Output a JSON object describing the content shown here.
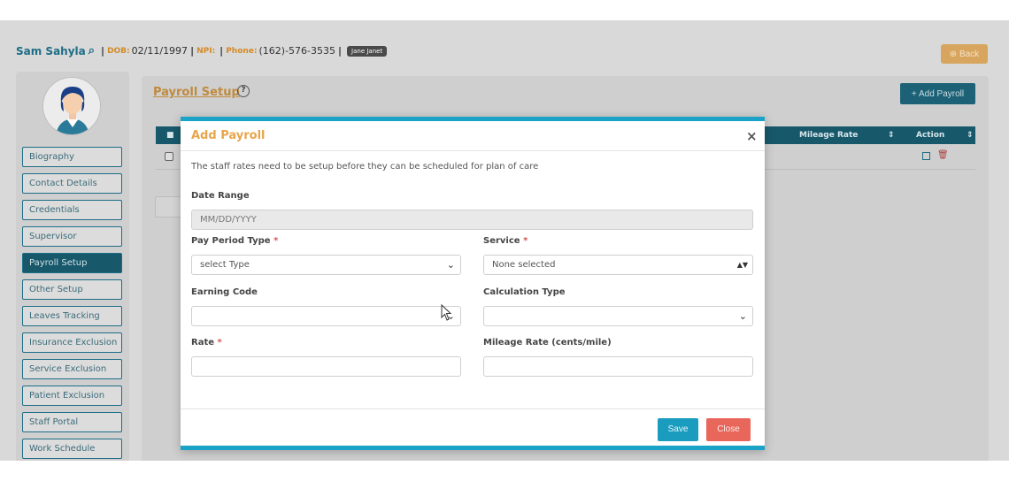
{
  "patient": {
    "name": "Sam Sahyla",
    "search_icon": "search-icon",
    "dob_label": "DOB:",
    "dob_value": "02/11/1997",
    "npi_label": "NPI:",
    "phone_label": "Phone:",
    "phone_value": "(162)-576-3535",
    "badge": "Jane Janet"
  },
  "back_button": "⊕ Back",
  "sidebar": {
    "items": [
      {
        "label": "Biography"
      },
      {
        "label": "Contact Details"
      },
      {
        "label": "Credentials"
      },
      {
        "label": "Supervisor"
      },
      {
        "label": "Payroll Setup"
      },
      {
        "label": "Other Setup"
      },
      {
        "label": "Leaves Tracking"
      },
      {
        "label": "Insurance Exclusion"
      },
      {
        "label": "Service Exclusion"
      },
      {
        "label": "Patient Exclusion"
      },
      {
        "label": "Staff Portal"
      },
      {
        "label": "Work Schedule"
      }
    ],
    "active_index": 4
  },
  "main": {
    "title": "Payroll Setup",
    "add_button": "+ Add Payroll",
    "columns": {
      "mileage_rate": "Mileage Rate",
      "action": "Action"
    }
  },
  "modal": {
    "title": "Add Payroll",
    "close_glyph": "×",
    "note": "The staff rates need to be setup before they can be scheduled for plan of care",
    "date_range": {
      "label": "Date Range",
      "placeholder": "MM/DD/YYYY"
    },
    "pay_period_type": {
      "label": "Pay Period Type",
      "value": "select Type"
    },
    "service": {
      "label": "Service",
      "value": "None selected"
    },
    "earning_code": {
      "label": "Earning Code",
      "value": ""
    },
    "calculation_type": {
      "label": "Calculation Type",
      "value": ""
    },
    "rate": {
      "label": "Rate",
      "value": ""
    },
    "mileage_rate": {
      "label": "Mileage Rate (cents/mile)",
      "value": ""
    },
    "required_mark": "*",
    "save_label": "Save",
    "close_label": "Close"
  }
}
